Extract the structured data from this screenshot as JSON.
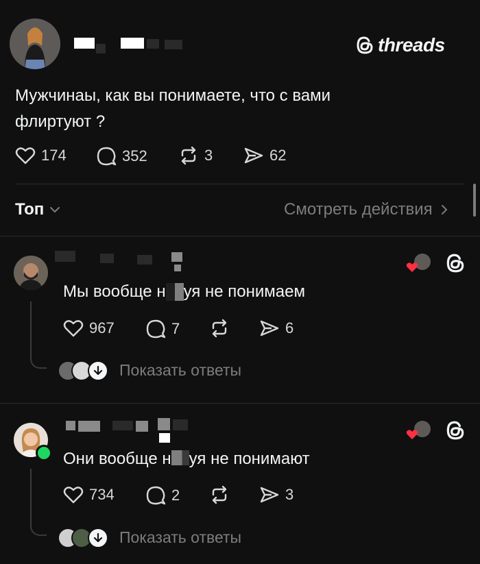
{
  "post": {
    "logo_text": "threads",
    "text_line1": "Мужчинаы, как вы понимаете, что с вами",
    "text_line2": "флиртуют ?",
    "likes": "174",
    "comments": "352",
    "reposts": "3",
    "shares": "62"
  },
  "sort": {
    "label": "Топ",
    "view_activity": "Смотреть действия"
  },
  "replies": [
    {
      "text_before": "Мы вообще н",
      "text_after": "уя не понимаем",
      "likes": "967",
      "comments": "7",
      "shares": "6",
      "show_replies": "Показать ответы"
    },
    {
      "text_before": "Они вообще н",
      "text_after": "уя не понимают",
      "likes": "734",
      "comments": "2",
      "shares": "3",
      "show_replies": "Показать ответы"
    }
  ],
  "colors": {
    "background": "#101010",
    "text": "#f3f5f7",
    "muted": "#7d7d7d",
    "heart": "#ff3040",
    "online": "#1ed760"
  }
}
